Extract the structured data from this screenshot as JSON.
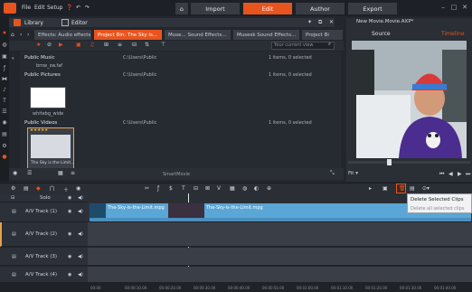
{
  "menubar": {
    "items": [
      "File",
      "Edit",
      "Setup"
    ],
    "tabs": [
      "Import",
      "Edit",
      "Author",
      "Export"
    ],
    "active_tab": "Edit"
  },
  "library": {
    "title": "Library",
    "editor_title": "Editor",
    "doc_tabs": [
      "Effects: Audio effects",
      "Project Bin: The Sky is...",
      "Muse... Sound Effects...",
      "Musesk Sound Effects...",
      "Your current view",
      "Project Bi"
    ],
    "search_placeholder": "Your current view",
    "groups": [
      {
        "name": "Public Music",
        "path": "C:\\Users\\Public",
        "count": "1 items, 0 selected",
        "item": "bmw_sw.faf"
      },
      {
        "name": "Public Pictures",
        "path": "C:\\Users\\Public",
        "count": "1 items, 0 selected",
        "item": "whitebg_wide"
      },
      {
        "name": "Public Videos",
        "path": "C:\\Users\\Public",
        "count": "1 items, 0 selected",
        "item": "The Sky is the Limit..."
      }
    ],
    "smartmovie": "SmartMovie"
  },
  "preview": {
    "title": "New Movie.Movie.AXP*",
    "source_label": "Source",
    "timeline_label": "Timeline"
  },
  "timeline": {
    "solo_label": "Solo",
    "tracks": [
      "A/V Track (1)",
      "A/V Track (2)",
      "A/V Track (3)",
      "A/V Track (4)"
    ],
    "clip_name": "The-Sky-is-the-Limit.mpg",
    "ruler_ticks": [
      "00:00",
      "00:00:10.00",
      "00:00:20.00",
      "00:00:30.00",
      "00:00:40.00",
      "00:00:50.00",
      "00:01:00.00",
      "00:01:10.00",
      "00:01:20.00",
      "00:01:30.00",
      "00:01:40.00"
    ]
  },
  "tooltip": {
    "line1": "Delete Selected Clips",
    "line2": "Delete all selected clips"
  },
  "colors": {
    "accent": "#e8541e",
    "clip": "#5aa6d6"
  }
}
